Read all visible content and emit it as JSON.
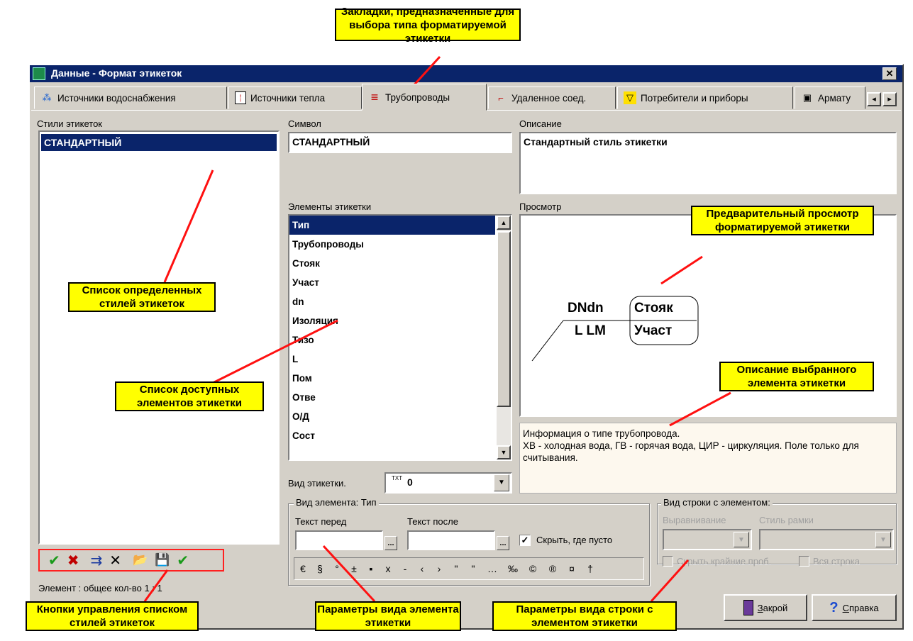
{
  "window": {
    "title": "Данные - Формат этикеток",
    "close_glyph": "✕"
  },
  "tabs": [
    {
      "label": "Источники водоснабжения",
      "icon": "water-source-icon",
      "glyph": "⁂"
    },
    {
      "label": "Источники тепла",
      "icon": "heat-source-icon",
      "glyph": "⁞"
    },
    {
      "label": "Трубопроводы",
      "icon": "pipe-icon",
      "glyph": "≡"
    },
    {
      "label": "Удаленное соед.",
      "icon": "remote-connection-icon",
      "glyph": "⌐"
    },
    {
      "label": "Потребители и приборы",
      "icon": "consumer-icon",
      "glyph": "▽"
    },
    {
      "label": "Армату",
      "icon": "fittings-icon",
      "glyph": "▣"
    }
  ],
  "tab_scroll": {
    "left": "◂",
    "right": "▸"
  },
  "styles_panel": {
    "label": "Стили этикеток",
    "items": [
      "СТАНДАРТНЫЙ"
    ],
    "status": "Элемент : общее кол-во 1 : 1"
  },
  "symbol": {
    "label": "Символ",
    "value": "СТАНДАРТНЫЙ"
  },
  "description": {
    "label": "Описание",
    "value": "Стандартный стиль этикетки"
  },
  "elements": {
    "label": "Элементы этикетки",
    "items": [
      "Тип",
      "Трубопроводы",
      "Стояк",
      "Участ",
      "dn",
      "Изоляция",
      "Тизо",
      "L",
      "Пом",
      "Отве",
      "О/Д",
      "Сост"
    ]
  },
  "preview": {
    "label": "Просмотр",
    "top_left": "DNdn",
    "top_right": "Стояк",
    "bottom_left": "L LM",
    "bottom_right": "Участ"
  },
  "info": {
    "text": "Информация о типе трубопровода.\nХВ - холодная вода, ГВ - горячая вода, ЦИР - циркуляция. Поле только для считывания."
  },
  "label_view": {
    "label": "Вид этикетки.",
    "value": "0",
    "icon_text": "TXT"
  },
  "element_view": {
    "title": "Вид элемента: Тип",
    "text_before_label": "Текст перед",
    "text_after_label": "Текст после",
    "hide_empty_label": "Скрыть, где пусто",
    "hide_empty_checked": true,
    "dots": "...",
    "symbols": [
      "€",
      "§",
      "°",
      "±",
      "▪",
      "x",
      "-",
      "‹",
      "›",
      "\"",
      "\"",
      "…",
      "‰",
      "©",
      "®",
      "¤",
      "†"
    ]
  },
  "row_view": {
    "title": "Вид строки с элементом:",
    "align_label": "Выравнивание",
    "frame_label": "Стиль рамки",
    "hide_edges_label": "Скрыть крайние проб.",
    "whole_row_label": "Вся строка"
  },
  "toolbar": {
    "buttons": [
      {
        "name": "apply-check-icon",
        "glyph": "✔",
        "color": "#1a9a1a"
      },
      {
        "name": "delete-x-icon",
        "glyph": "✖",
        "color": "#c00000"
      },
      {
        "name": "insert-icon",
        "glyph": "⇉",
        "color": "#1a3aa0"
      },
      {
        "name": "remove-icon",
        "glyph": "✕",
        "color": "#000000"
      },
      {
        "name": "open-folder-icon",
        "glyph": "📂",
        "color": "#c8a000"
      },
      {
        "name": "save-disk-icon",
        "glyph": "💾",
        "color": "#000000"
      },
      {
        "name": "confirm-check-icon",
        "glyph": "✔",
        "color": "#1a9a1a"
      }
    ]
  },
  "buttons": {
    "close_label": "Закрой",
    "close_underline": "З",
    "close_rest": "акрой",
    "help_underline": "С",
    "help_rest": "правка",
    "help_glyph": "?"
  },
  "callouts": {
    "tabs": "Закладки, предназначенные для выбора типа форматируемой этикетки",
    "preview": "Предварительный просмотр форматируемой этикетки",
    "styles_list": "Список определенных стилей этикеток",
    "elements_list": "Список доступных элементов этикетки",
    "element_desc": "Описание выбранного элемента этикетки",
    "style_buttons": "Кнопки управления списком стилей этикеток",
    "element_params": "Параметры вида элемента этикетки",
    "row_params": "Параметры вида строки с элементом этикетки"
  },
  "colors": {
    "callout_bg": "#ffff00",
    "arrow": "#ff0000",
    "titlebar": "#0a246a",
    "selection": "#0a246a",
    "info_bg": "#fdf8ee"
  }
}
